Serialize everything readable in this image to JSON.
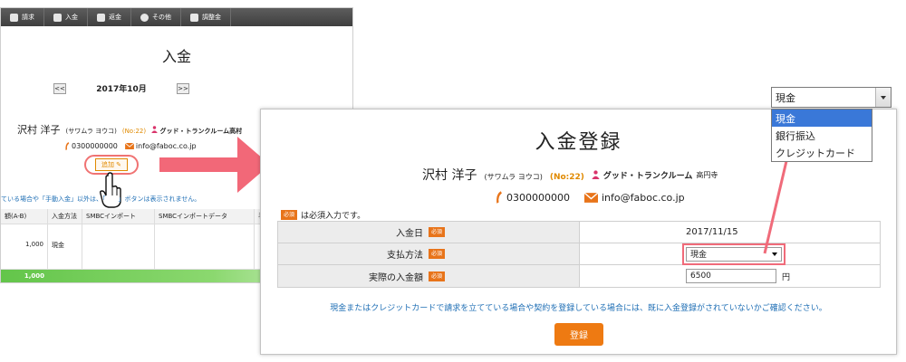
{
  "background": {
    "toolbar": {
      "items": [
        "請求",
        "入金",
        "返金",
        "その他",
        "調整金"
      ]
    },
    "title": "入金",
    "month": {
      "prev": "<<",
      "label": "2017年10月",
      "next": ">>"
    },
    "customer": {
      "name": "沢村 洋子",
      "kana": "(サワムラ ヨウコ)",
      "number": "(No:22)",
      "shop": "グッド・トランクルーム高村",
      "phone": "0300000000",
      "email": "info@faboc.co.jp"
    },
    "add_button_label": "追加",
    "notice": "ている場合や「手動入金」以外は、「　　」ボタンは表示されません。",
    "table": {
      "headers": [
        "額(A-B)",
        "入金方法",
        "SMBCインポート",
        "SMBCインポートデータ",
        "手"
      ],
      "rows": [
        [
          "1,000",
          "現金",
          "",
          "",
          ""
        ]
      ],
      "total": "1,000"
    }
  },
  "dialog": {
    "title": "入金登録",
    "customer": {
      "name": "沢村 洋子",
      "kana": "(サワムラ ヨウコ)",
      "number": "(No:22)",
      "shop": "グッド・トランクルーム",
      "shop_branch": "高円寺",
      "phone": "0300000000",
      "email": "info@faboc.co.jp"
    },
    "required_badge": "必須",
    "required_note": "は必須入力です。",
    "fields": {
      "date_label": "入金日",
      "date_value": "2017/11/15",
      "method_label": "支払方法",
      "method_value": "現金",
      "amount_label": "実際の入金額",
      "amount_value": "6500",
      "amount_unit": "円"
    },
    "info": "現金またはクレジットカードで請求を立てている場合や契約を登録している場合には、既に入金登録がされていないかご確認ください。",
    "submit_label": "登録"
  },
  "dropdown": {
    "selected": "現金",
    "options": [
      "現金",
      "銀行振込",
      "クレジットカード"
    ]
  },
  "colors": {
    "accent_orange": "#ee7a12",
    "highlight_pink": "#f06b7a",
    "info_blue": "#1f6fb5",
    "selected_blue": "#3a78d8"
  }
}
